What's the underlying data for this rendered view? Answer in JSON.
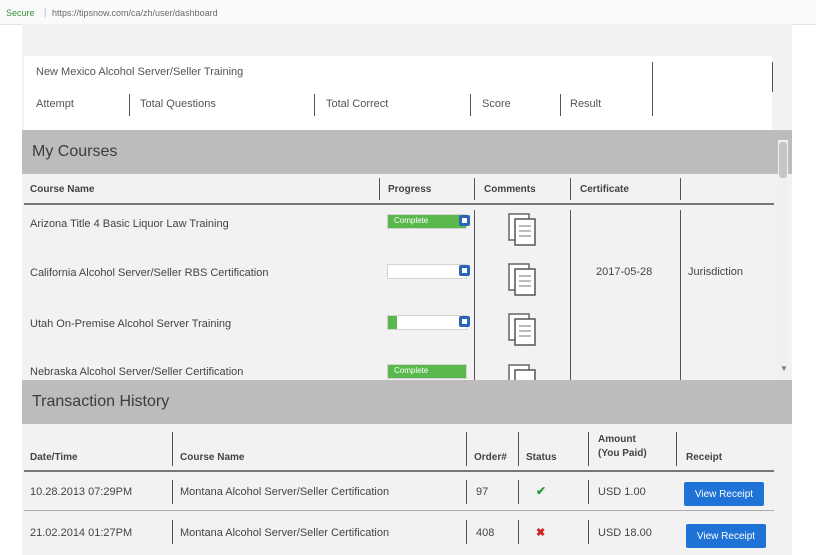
{
  "address_bar": {
    "secure_label": "Secure",
    "url": "https://tipsnow.com/ca/zh/user/dashboard"
  },
  "top_table": {
    "course_title": "New Mexico Alcohol Server/Seller Training",
    "cols": [
      "Attempt",
      "Total Questions",
      "Total Correct",
      "Score",
      "Result"
    ]
  },
  "my_courses": {
    "title": "My Courses",
    "headers": {
      "course_name": "Course Name",
      "progress": "Progress",
      "comments": "Comments",
      "certificate": "Certificate"
    },
    "rows": [
      {
        "name": "Arizona Title 4 Basic Liquor Law Training",
        "progress": 100,
        "progress_label": "Complete",
        "certificate_date": "",
        "certificate_extra": ""
      },
      {
        "name": "California Alcohol Server/Seller RBS Certification",
        "progress": 0,
        "progress_label": "",
        "certificate_date": "2017-05-28",
        "certificate_extra": "Jurisdiction"
      },
      {
        "name": "Utah On-Premise Alcohol Server Training",
        "progress": 12,
        "progress_label": "",
        "certificate_date": "",
        "certificate_extra": ""
      },
      {
        "name": "Nebraska Alcohol Server/Seller Certification",
        "progress": 100,
        "progress_label": "Complete",
        "certificate_date": "",
        "certificate_extra": ""
      }
    ]
  },
  "transactions": {
    "title": "Transaction History",
    "headers": {
      "datetime": "Date/Time",
      "course_name": "Course Name",
      "order": "Order#",
      "status": "Status",
      "amount_line1": "Amount",
      "amount_line2": "(You Paid)",
      "receipt": "Receipt"
    },
    "rows": [
      {
        "datetime": "10.28.2013 07:29PM",
        "course": "Montana Alcohol Server/Seller Certification",
        "order": "97",
        "status": "paid",
        "amount": "USD 1.00",
        "receipt_label": "View Receipt"
      },
      {
        "datetime": "21.02.2014 01:27PM",
        "course": "Montana Alcohol Server/Seller Certification",
        "order": "408",
        "status": "failed",
        "amount": "USD 18.00",
        "receipt_label": "View Receipt"
      }
    ]
  },
  "colors": {
    "section_header": "#bdbbbb",
    "progress_fill": "#58b84c",
    "button": "#1f73d6",
    "mini_button": "#2e64b8"
  }
}
